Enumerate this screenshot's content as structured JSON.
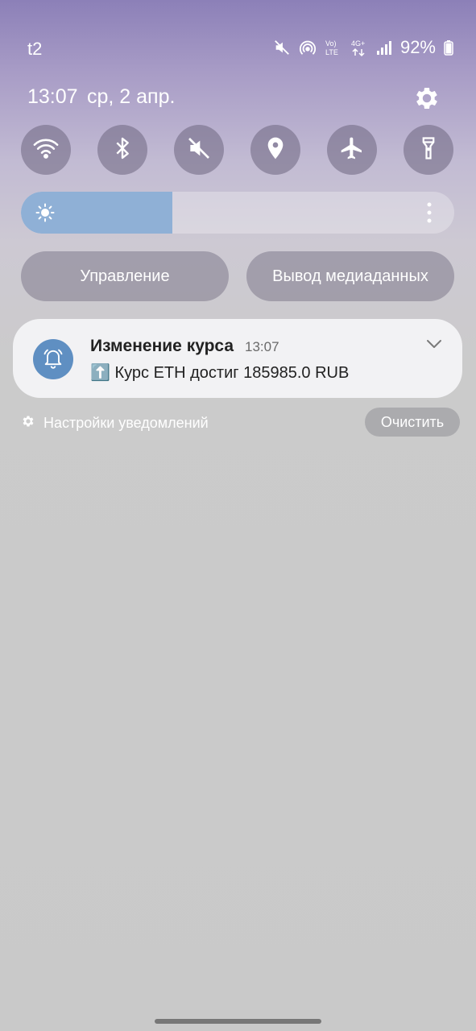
{
  "status_bar": {
    "carrier": "t2",
    "battery": "92%",
    "icons": [
      "mute-icon",
      "hotspot-icon",
      "volte-icon",
      "4g-icon",
      "signal-icon",
      "battery-icon"
    ]
  },
  "header": {
    "time": "13:07",
    "date": "ср, 2 апр.",
    "settings_icon": "gear-icon"
  },
  "quick_toggles": [
    {
      "name": "wifi",
      "icon": "wifi-icon"
    },
    {
      "name": "bluetooth",
      "icon": "bluetooth-icon"
    },
    {
      "name": "sound",
      "icon": "mute-icon"
    },
    {
      "name": "location",
      "icon": "location-icon"
    },
    {
      "name": "airplane-mode",
      "icon": "airplane-icon"
    },
    {
      "name": "flashlight",
      "icon": "flashlight-icon"
    }
  ],
  "brightness": {
    "level": 0.35,
    "icon": "sun-icon",
    "accent": "#8fb0d6"
  },
  "buttons": {
    "control": "Управление",
    "media_output": "Вывод медиаданных"
  },
  "notification": {
    "title": "Изменение курса",
    "time": "13:07",
    "text": "⬆️ Курс ETH достиг 185985.0 RUB",
    "icon": "bell-icon",
    "icon_color": "#5f8fc2"
  },
  "footer": {
    "settings_label": "Настройки уведомлений",
    "clear_label": "Очистить"
  }
}
